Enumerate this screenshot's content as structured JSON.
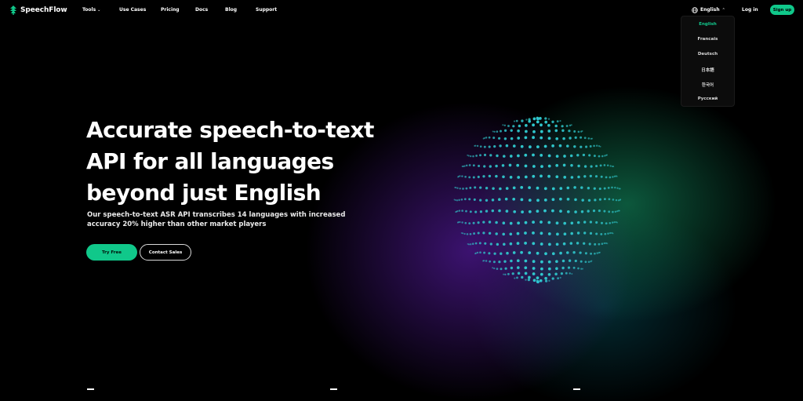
{
  "brand": {
    "name": "SpeechFlow",
    "accent_color": "#10c88a"
  },
  "nav": {
    "tools": "Tools",
    "use_cases": "Use Cases",
    "pricing": "Pricing",
    "docs": "Docs",
    "blog": "Blog",
    "support": "Support"
  },
  "header": {
    "language": "English",
    "login": "Log in",
    "signup": "Sign up"
  },
  "language_menu": {
    "options": [
      "English",
      "Francais",
      "Deutsch",
      "日本語",
      "한국어",
      "Русский"
    ],
    "selected": "English"
  },
  "hero": {
    "title_lines": [
      "Accurate speech-to-text",
      "API for all languages",
      "beyond just English"
    ],
    "subtitle_lines": [
      "Our speech-to-text ASR API transcribes 14 languages with increased",
      "accuracy 20% higher than other market players"
    ],
    "primary_cta": "Try Free",
    "secondary_cta": "Contact Sales"
  },
  "icons": {
    "logo": "speechflow-logo-icon",
    "globe": "globe-icon",
    "chevron": "chevron-down-icon"
  }
}
